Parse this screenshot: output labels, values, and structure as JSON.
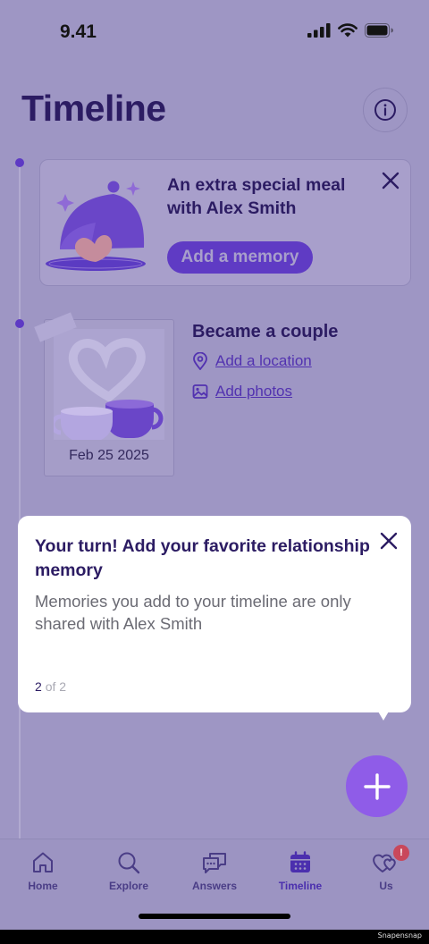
{
  "status_bar": {
    "time": "9.41"
  },
  "header": {
    "title": "Timeline"
  },
  "suggestion_card": {
    "title": "An extra special meal with Alex Smith",
    "button_label": "Add a memory"
  },
  "memory_card": {
    "title": "Became a couple",
    "date": "Feb 25 2025",
    "location_link": "Add a location",
    "photos_link": "Add photos"
  },
  "tooltip": {
    "title": "Your turn! Add your favorite relationship memory",
    "body": "Memories you add to your timeline are only shared with Alex Smith",
    "page_current": "2",
    "page_rest": "of 2"
  },
  "tabs": [
    {
      "label": "Home",
      "icon": "home-icon"
    },
    {
      "label": "Explore",
      "icon": "search-icon"
    },
    {
      "label": "Answers",
      "icon": "chat-bubbles-icon"
    },
    {
      "label": "Timeline",
      "icon": "calendar-icon",
      "active": true
    },
    {
      "label": "Us",
      "icon": "hearts-icon",
      "badge": "!"
    }
  ],
  "watermark": "Snapensnap",
  "colors": {
    "background": "#9e96c4",
    "primary": "#5f3bc4",
    "title": "#2c1c63",
    "fab": "#8f5ce8",
    "badge": "#c9485b"
  }
}
